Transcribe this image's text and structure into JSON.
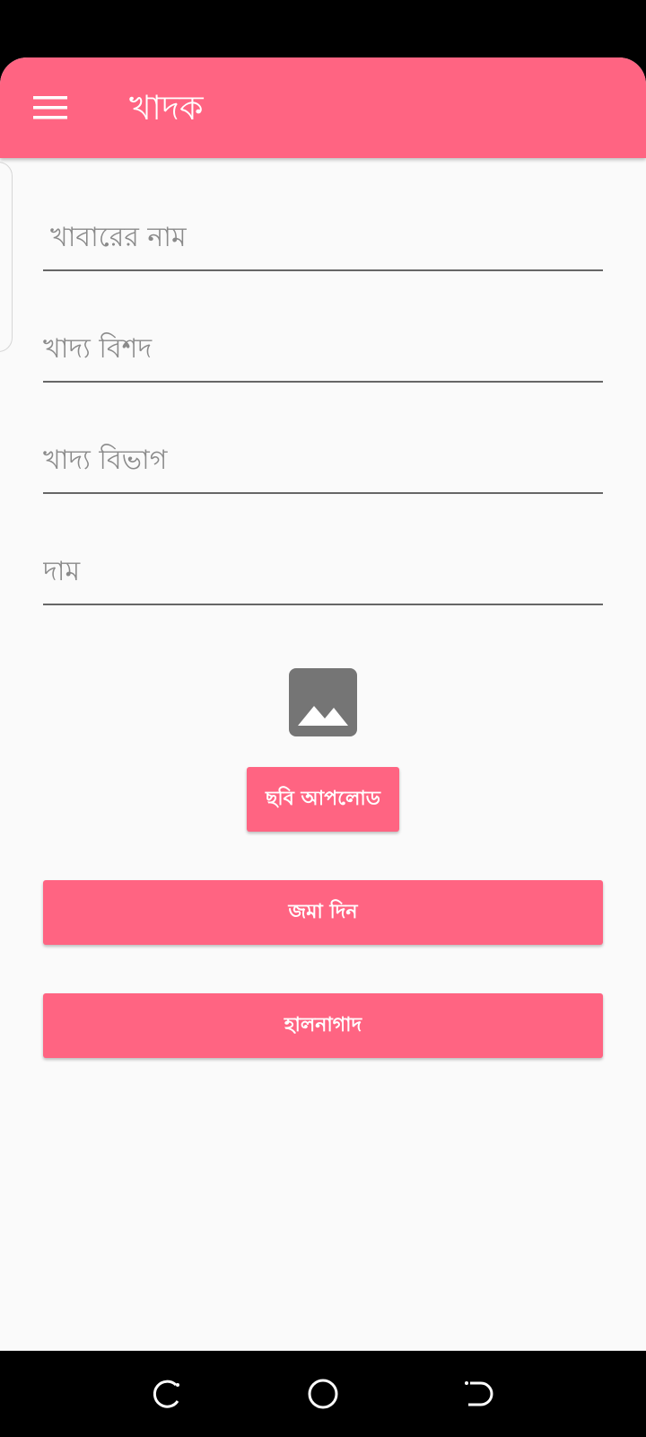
{
  "app": {
    "title": "খাদক",
    "theme_color": "#ff6482"
  },
  "toolbar": {
    "menu_icon": "hamburger-menu-icon"
  },
  "form": {
    "food_name": {
      "placeholder": "খাবারের নাম",
      "value": ""
    },
    "food_details": {
      "placeholder": "খাদ্য বিশদ",
      "value": ""
    },
    "food_category": {
      "placeholder": "খাদ্য বিভাগ",
      "value": ""
    },
    "price": {
      "placeholder": "দাম",
      "value": ""
    }
  },
  "image_preview": {
    "icon": "image-placeholder-icon"
  },
  "buttons": {
    "upload_label": "ছবি আপলোড",
    "submit_label": "জমা দিন",
    "update_label": "হালনাগাদ"
  },
  "nav": {
    "recents_icon": "recent-apps-icon",
    "home_icon": "home-circle-icon",
    "back_icon": "back-icon"
  }
}
